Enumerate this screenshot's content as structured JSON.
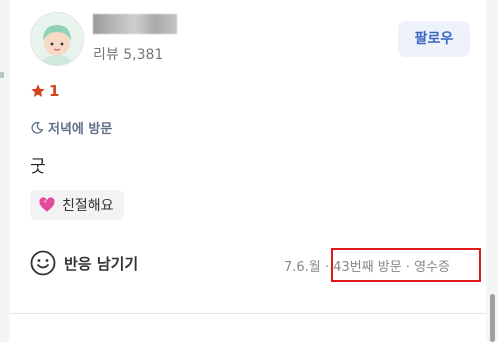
{
  "reviewer": {
    "avatar_icon": "avatar-illustration",
    "review_count": "리뷰 5,381",
    "follow_label": "팔로우"
  },
  "review": {
    "rating": "1",
    "visit_time": "저녁에 방문",
    "body": "굿",
    "tags": [
      "친절해요"
    ]
  },
  "footer": {
    "reaction_label": "반응 남기기",
    "meta": "7.6.월 · 43번째 방문 · 영수증"
  },
  "colors": {
    "accent_blue": "#3d67c4",
    "star_red": "#d2441f",
    "highlight_red": "#e01818"
  }
}
